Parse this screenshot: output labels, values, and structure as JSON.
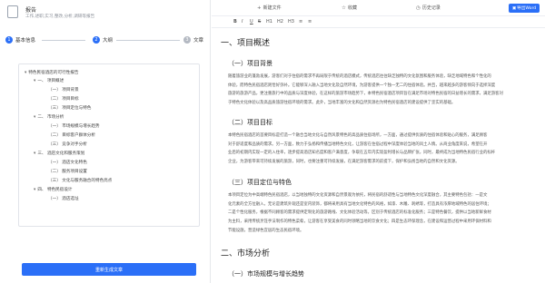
{
  "document": {
    "title": "报告",
    "subtitle": "工作,述职,实习,整改,分析,调研等报告"
  },
  "steps": [
    {
      "num": "1",
      "label": "基本信息"
    },
    {
      "num": "2",
      "label": "大纲"
    },
    {
      "num": "3",
      "label": "文章"
    }
  ],
  "outline": {
    "root": "特色民宿酒店的可行性报告",
    "items": [
      {
        "level": 1,
        "label": "一、 项目概述"
      },
      {
        "level": 2,
        "label": "（一） 项目背景"
      },
      {
        "level": 2,
        "label": "（二） 项目目标"
      },
      {
        "level": 2,
        "label": "（三） 项目定位与特色"
      },
      {
        "level": 1,
        "label": "二、 市场分析"
      },
      {
        "level": 2,
        "label": "（一） 市场规模与增长趋势"
      },
      {
        "level": 2,
        "label": "（二） 目标客户群体分析"
      },
      {
        "level": 2,
        "label": "（三） 竞争对手分析"
      },
      {
        "level": 1,
        "label": "三、 酒店文化和服务策划"
      },
      {
        "level": 2,
        "label": "（一） 酒店文化特色"
      },
      {
        "level": 2,
        "label": "（二） 服务项目设置"
      },
      {
        "level": 2,
        "label": "（三） 文化与服务融合的特色亮点"
      },
      {
        "level": 1,
        "label": "四、 特色民宿设计"
      },
      {
        "level": 2,
        "label": "（一） 酒店选址"
      }
    ]
  },
  "buttons": {
    "generate": "重新生成文章",
    "collapse": "«",
    "export": "导出Word"
  },
  "toolbar": {
    "new_file": "新建文件",
    "favorite": "收藏",
    "history": "历史记录",
    "format": [
      "B",
      "I",
      "U",
      "S",
      "H1",
      "H2",
      "H3",
      "≡",
      "≡"
    ]
  },
  "article": {
    "h1_overview": "一、项目概述",
    "h2_background": "（一）项目背景",
    "p_background": [
      "随着旅游业的蓬勃发展，游客们对于住宿的需求不再局限于传统的酒店模式，传统酒店往往缺乏独特的文化氛围和服务体验，缺乏地域特色和个性化的",
      "体验，而特色民宿酒店则恰好弥补。它能够深入融入当地文化及自然环境，为游客提供一个独一无二的住宿体验。并且，越来越多的游客倾向于选择深度",
      "旅游的旅游产品，更注重旅行中的品质与深度体验，在这样的旅游市场趋势下，本特色民宿酒店项目旨在满足市场对特色民宿的日益增长的需求，满足游客对",
      "于特色文化体验以及高品质旅游住宿环境的需求。此外，当地丰富的文化和自然资源也为特色民宿酒店的建设提供了坚实的基础。"
    ],
    "h2_goal": "（二）项目目标",
    "p_goal": [
      "本特色民宿酒店的首要目标是打造一个融合当地文化与自然风景特色的高品质住宿场所，一方面，通过提供优质的住宿体验和贴心的服务，满足顾客",
      "对于舒适度和品质的需求。另一方面，致力于弘扬和传播当地特色文化，让游客在住宿过程中深度体验当地的风土人情。从商业角度来说，希望在开",
      "业后的初期内实现一定的入住率，逐步提高酒店知名度和客户满意度，争取在五年内实现盈利增长与品牌扩张，同时，最终成为当地特色民宿行业的标杆",
      "企业，为游客带来可持续发展的旅游，同时，也要注重可持续发展，在满足游客需求的前提下，保护和弘扬当地的自然和文化资源。"
    ],
    "h2_position": "（三）项目定位与特色",
    "p_position": [
      "本项目定位为中高端特色民宿酒店，以当地独特的文化资源和自然景观为依托，将民宿的舒适性与当地特色文化深度融合，其主要特色包括：一是文",
      "化元素的全方位融入，无论是建筑外观还是室内装饰，都将采用具有当地文化特色的风格，如漆、木雕、刺绣等，打造具有浓厚地域特色的居住环境；",
      "二是个性化服务，根据不同顾客的需求提供定制化的旅游路线、文化体验活动等。区别于传统酒店的标准化服务；三是特色餐饮，提供以当地新鲜食材",
      "为主料，采用传统烹饪手法制作的特色菜肴，让游客在享受美食的同时领略当地的饮食文化；四是生态环保理念，在建设和运营过程中采用环保材料和",
      "节能设施，营造绿色宜居的生态民宿环境。"
    ],
    "h1_market": "二、市场分析",
    "h2_market_size": "（一）市场规模与增长趋势"
  }
}
